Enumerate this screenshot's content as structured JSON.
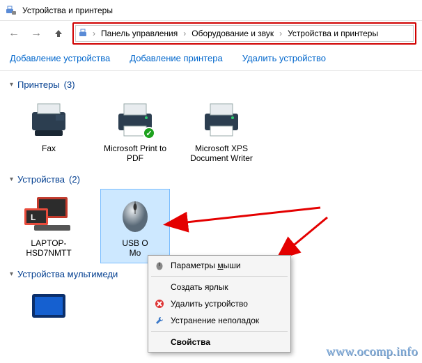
{
  "window": {
    "title": "Устройства и принтеры"
  },
  "breadcrumb": {
    "items": [
      "Панель управления",
      "Оборудование и звук",
      "Устройства и принтеры"
    ]
  },
  "commands": {
    "add_device": "Добавление устройства",
    "add_printer": "Добавление принтера",
    "remove_device": "Удалить устройство"
  },
  "groups": {
    "printers": {
      "label": "Принтеры",
      "count": "(3)"
    },
    "devices": {
      "label": "Устройства",
      "count": "(2)"
    },
    "multimedia": {
      "label": "Устройства мультимеди"
    }
  },
  "printers": [
    {
      "name": "Fax"
    },
    {
      "name": "Microsoft Print to PDF"
    },
    {
      "name": "Microsoft XPS Document Writer"
    }
  ],
  "devices": [
    {
      "name": "LAPTOP-HSD7NMTT"
    },
    {
      "name": "USB Optical Mouse",
      "name_visible": "USB O\nMo"
    }
  ],
  "context_menu": {
    "mouse_params_prefix": "Параметры ",
    "mouse_params_underlined": "м",
    "mouse_params_suffix": "ыши",
    "create_shortcut": "Создать ярлык",
    "remove": "Удалить устройство",
    "troubleshoot": "Устранение неполадок",
    "properties": "Свойства"
  },
  "watermark": "www.ocomp.info"
}
